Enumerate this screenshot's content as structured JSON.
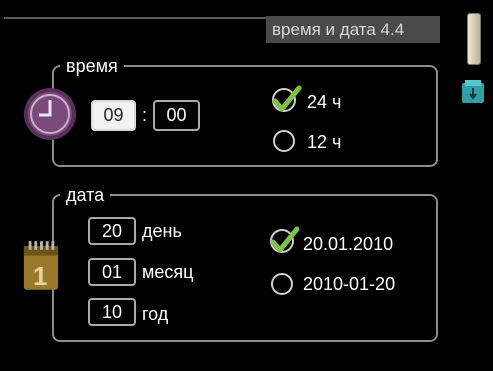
{
  "header": {
    "title": "время и дата  4.4"
  },
  "time_section": {
    "legend": "время",
    "hour": "09",
    "separator": ":",
    "minute": "00",
    "format_options": [
      {
        "label": "24 ч",
        "selected": true
      },
      {
        "label": "12 ч",
        "selected": false
      }
    ]
  },
  "date_section": {
    "legend": "дата",
    "fields": [
      {
        "value": "20",
        "label": "день"
      },
      {
        "value": "01",
        "label": "месяц"
      },
      {
        "value": "10",
        "label": "год"
      }
    ],
    "calendar_icon_text": "1",
    "format_options": [
      {
        "label": "20.01.2010",
        "selected": true
      },
      {
        "label": "2010-01-20",
        "selected": false
      }
    ]
  },
  "colors": {
    "clock_icon": "#6a3f6a",
    "calendar_icon": "#9a7a2a",
    "check": "#7fc241",
    "frame": "#8d8d8d"
  }
}
